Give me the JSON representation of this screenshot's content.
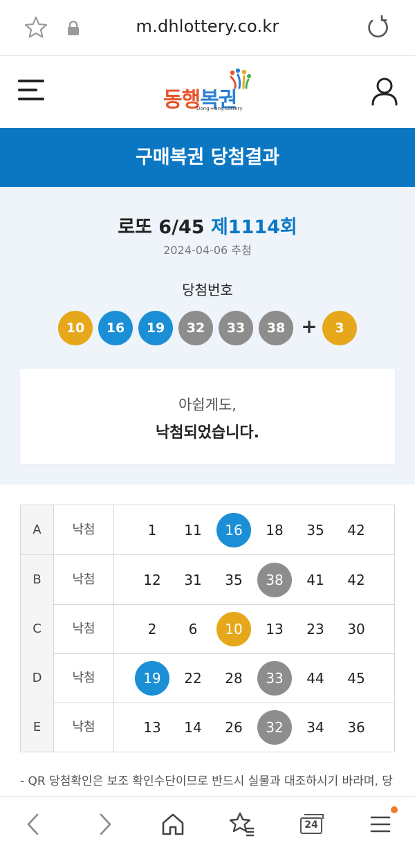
{
  "browser": {
    "url": "m.dhlottery.co.kr",
    "tab_count": "24"
  },
  "site": {
    "logo_text_main": "동행",
    "logo_text_accent": "복권",
    "logo_sub": "Dong-Hang Lottery"
  },
  "page": {
    "title": "구매복권 당첨결과"
  },
  "draw": {
    "game_name": "로또 6/45",
    "round_label": "제1114회",
    "date": "2024-04-06 추첨",
    "winning_label": "당첨번호",
    "numbers": [
      {
        "value": "10",
        "color": "yellow"
      },
      {
        "value": "16",
        "color": "blue"
      },
      {
        "value": "19",
        "color": "blue"
      },
      {
        "value": "32",
        "color": "gray"
      },
      {
        "value": "33",
        "color": "gray"
      },
      {
        "value": "38",
        "color": "gray"
      }
    ],
    "plus": "+",
    "bonus": {
      "value": "3",
      "color": "yellow"
    }
  },
  "message": {
    "line1": "아쉽게도,",
    "line2": "낙첨되었습니다."
  },
  "games": [
    {
      "label": "A",
      "result": "낙첨",
      "numbers": [
        "1",
        "11",
        "16",
        "18",
        "35",
        "42"
      ],
      "highlights": [
        "",
        "",
        "blue",
        "",
        "",
        ""
      ]
    },
    {
      "label": "B",
      "result": "낙첨",
      "numbers": [
        "12",
        "31",
        "35",
        "38",
        "41",
        "42"
      ],
      "highlights": [
        "",
        "",
        "",
        "gray",
        "",
        ""
      ]
    },
    {
      "label": "C",
      "result": "낙첨",
      "numbers": [
        "2",
        "6",
        "10",
        "13",
        "23",
        "30"
      ],
      "highlights": [
        "",
        "",
        "yellow",
        "",
        "",
        ""
      ]
    },
    {
      "label": "D",
      "result": "낙첨",
      "numbers": [
        "19",
        "22",
        "28",
        "33",
        "44",
        "45"
      ],
      "highlights": [
        "blue",
        "",
        "",
        "gray",
        "",
        ""
      ]
    },
    {
      "label": "E",
      "result": "낙첨",
      "numbers": [
        "13",
        "14",
        "26",
        "32",
        "34",
        "36"
      ],
      "highlights": [
        "",
        "",
        "",
        "gray",
        "",
        ""
      ]
    }
  ],
  "notice": "- QR 당첨확인은 보조 확인수단이므로 반드시 실물과 대조하시기 바라며, 당",
  "colors": {
    "brand_blue": "#0b77c3",
    "ball_yellow": "#e6a81a",
    "ball_blue": "#1b8fd6",
    "ball_gray": "#8d8d8d"
  },
  "icons": {
    "bookmark": "star-icon",
    "lock": "lock-icon",
    "reload": "reload-icon",
    "menu": "hamburger-icon",
    "user": "user-icon",
    "back": "chevron-left-icon",
    "forward": "chevron-right-icon",
    "home": "home-icon",
    "bookmarks": "bookmark-list-icon",
    "tabs": "tabs-icon",
    "browser_menu": "menu-icon"
  }
}
